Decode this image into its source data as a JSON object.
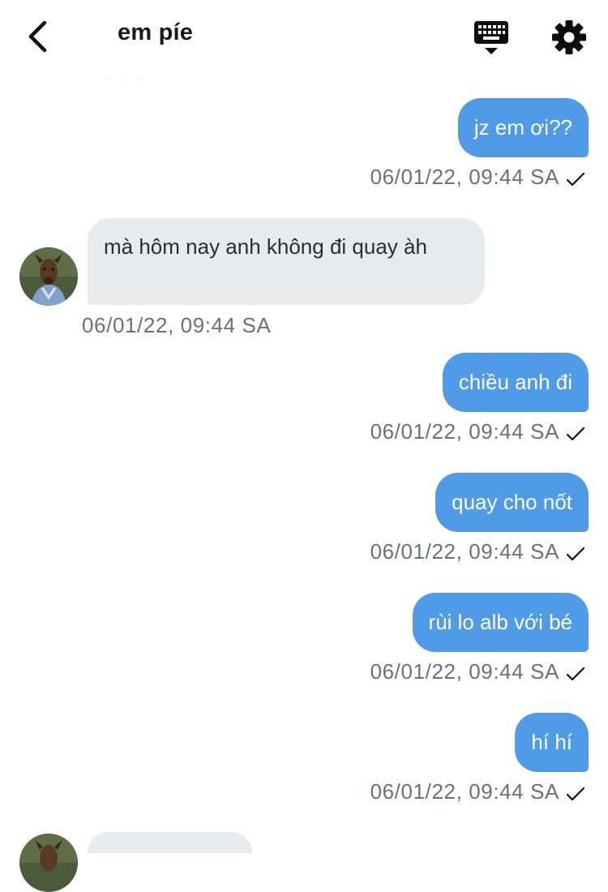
{
  "header": {
    "title": "em píe",
    "faded_partial": "· ·  ·"
  },
  "messages": [
    {
      "direction": "outgoing",
      "text": "jz em ơi??",
      "timestamp": "06/01/22, 09:44 SA",
      "status": "sent"
    },
    {
      "direction": "incoming",
      "text": "mà hôm nay anh không đi quay àh",
      "timestamp": "06/01/22, 09:44 SA"
    },
    {
      "direction": "outgoing",
      "text": "chiều anh đi",
      "timestamp": "06/01/22, 09:44 SA",
      "status": "sent"
    },
    {
      "direction": "outgoing",
      "text": "quay cho nốt",
      "timestamp": "06/01/22, 09:44 SA",
      "status": "sent"
    },
    {
      "direction": "outgoing",
      "text": "rùi lo alb với bé",
      "timestamp": "06/01/22, 09:44 SA",
      "status": "sent"
    },
    {
      "direction": "outgoing",
      "text": "hí hí",
      "timestamp": "06/01/22, 09:44 SA",
      "status": "sent"
    },
    {
      "direction": "incoming",
      "text": "",
      "timestamp": ""
    }
  ],
  "colors": {
    "outgoing_bubble": "#4f9be8",
    "incoming_bubble": "#e8eaed",
    "timestamp": "#6a717c"
  },
  "icons": {
    "back": "chevron-left-icon",
    "keyboard": "keyboard-icon",
    "settings": "gear-icon",
    "read_status": "checkmark-icon"
  }
}
